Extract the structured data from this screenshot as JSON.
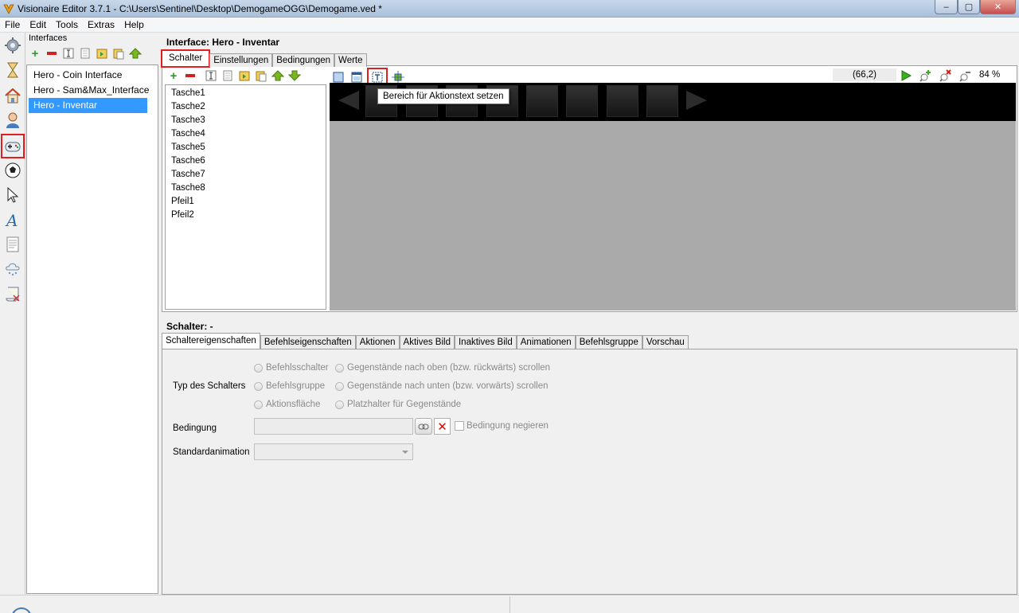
{
  "window": {
    "title": "Visionaire Editor 3.7.1 - C:\\Users\\Sentinel\\Desktop\\DemogameOGG\\Demogame.ved *",
    "min_label": "–",
    "max_label": "▢",
    "close_label": "✕"
  },
  "menu": [
    "File",
    "Edit",
    "Tools",
    "Extras",
    "Help"
  ],
  "interfaces": {
    "label": "Interfaces",
    "items": [
      "Hero - Coin  Interface",
      "Hero - Sam&Max_Interface",
      "Hero - Inventar"
    ],
    "selected_index": 2
  },
  "main": {
    "title": "Interface: Hero - Inventar",
    "tabs": [
      "Schalter",
      "Einstellungen",
      "Bedingungen",
      "Werte"
    ],
    "active_tab": 0,
    "switches": [
      "Tasche1",
      "Tasche2",
      "Tasche3",
      "Tasche4",
      "Tasche5",
      "Tasche6",
      "Tasche7",
      "Tasche8",
      "Pfeil1",
      "Pfeil2"
    ],
    "tooltip": "Bereich für Aktionstext setzen",
    "coordinates": "(66,2)",
    "zoom": "84 %"
  },
  "lower": {
    "title": "Schalter: -",
    "tabs": [
      "Schaltereigenschaften",
      "Befehlseigenschaften",
      "Aktionen",
      "Aktives Bild",
      "Inaktives Bild",
      "Animationen",
      "Befehlsgruppe",
      "Vorschau"
    ],
    "active_tab": 0,
    "type_label": "Typ des Schalters",
    "radios_left": [
      "Befehlsschalter",
      "Befehlsgruppe",
      "Aktionsfläche"
    ],
    "radios_right": [
      "Gegenstände nach oben (bzw. rückwärts) scrollen",
      "Gegenstände nach unten (bzw. vorwärts) scrollen",
      "Platzhalter für Gegenstände"
    ],
    "condition_label": "Bedingung",
    "condition_clear": "✕",
    "negate_label": "Bedingung negieren",
    "anim_label": "Standardanimation"
  },
  "colors": {
    "selection": "#3399ff",
    "highlight_red": "#e02020",
    "canvas_gray": "#aaaaaa"
  }
}
